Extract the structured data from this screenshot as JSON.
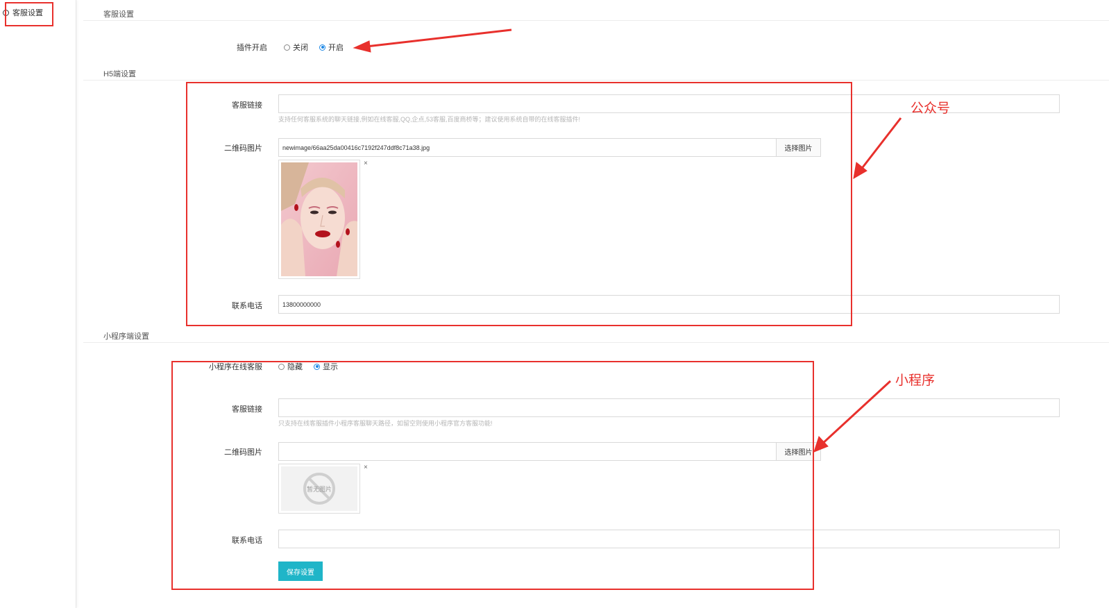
{
  "sidebar": {
    "item_label": "客服设置"
  },
  "sections": {
    "top_title": "客服设置",
    "h5_title": "H5端设置",
    "mini_title": "小程序端设置"
  },
  "plugin": {
    "label": "插件开启",
    "options": [
      "关闭",
      "开启"
    ],
    "selected": "开启"
  },
  "h5": {
    "link_label": "客服链接",
    "link_value": "",
    "link_help": "支持任何客服系统的聊天链接,例如在线客服,QQ,企点,53客服,百度商桥等；建议使用系统自带的在线客服插件!",
    "qr_label": "二维码图片",
    "qr_value": "newimage/66aa25da00416c7192f247ddf8c71a38.jpg",
    "pick_label": "选择图片",
    "close_glyph": "×",
    "phone_label": "联系电话",
    "phone_value": "13800000000"
  },
  "mini": {
    "online_label": "小程序在线客服",
    "options": [
      "隐藏",
      "显示"
    ],
    "selected": "显示",
    "link_label": "客服链接",
    "link_value": "",
    "link_help": "只支持在线客服插件小程序客服聊天路径，如留空则使用小程序官方客服功能!",
    "qr_label": "二维码图片",
    "qr_value": "",
    "pick_label": "选择图片",
    "close_glyph": "×",
    "placeholder_text": "暂无图片",
    "phone_label": "联系电话",
    "phone_value": ""
  },
  "save_label": "保存设置",
  "annotations": {
    "gzh": "公众号",
    "mini": "小程序",
    "color": "#e8302c"
  },
  "colors": {
    "accent": "#1fb5c8",
    "radio": "#1e88e5"
  }
}
